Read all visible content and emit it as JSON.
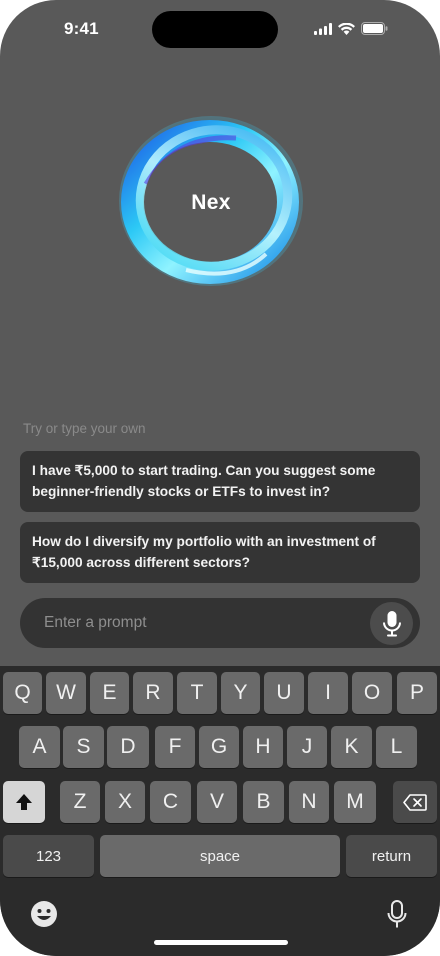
{
  "status": {
    "time": "9:41"
  },
  "assistant": {
    "name": "Nex"
  },
  "suggestions": {
    "hint": "Try or type your own",
    "items": [
      {
        "text": "I have ₹5,000 to start trading. Can you suggest some beginner-friendly stocks or ETFs to invest in?"
      },
      {
        "text": "How do I diversify my portfolio with an investment of ₹15,000 across different sectors?"
      }
    ]
  },
  "prompt": {
    "placeholder": "Enter a prompt"
  },
  "keyboard": {
    "row1": [
      "Q",
      "W",
      "E",
      "R",
      "T",
      "Y",
      "U",
      "I",
      "O",
      "P"
    ],
    "row2": [
      "A",
      "S",
      "D",
      "F",
      "G",
      "H",
      "J",
      "K",
      "L"
    ],
    "row3": [
      "Z",
      "X",
      "C",
      "V",
      "B",
      "N",
      "M"
    ],
    "numbers_label": "123",
    "space_label": "space",
    "return_label": "return"
  },
  "colors": {
    "background": "#595959",
    "card": "#343434",
    "keyboard": "#2b2b2b",
    "orb_cyan": "#29d3f2",
    "orb_blue": "#1b6ee8"
  }
}
